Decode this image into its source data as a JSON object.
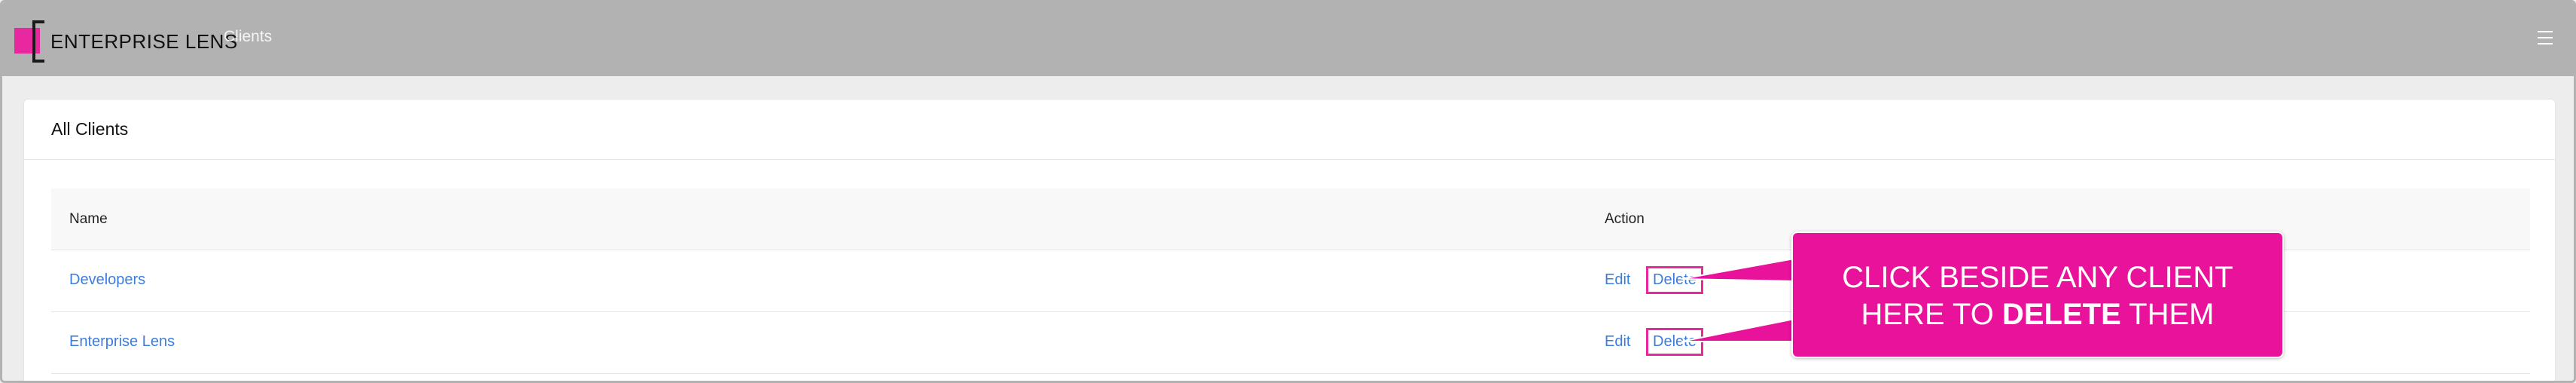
{
  "app": {
    "logo_text": "ENTERPRISE LENS",
    "nav_link": "Clients",
    "brand_color": "#e8289f"
  },
  "page": {
    "title": "All Clients"
  },
  "table": {
    "columns": [
      "Name",
      "Action"
    ],
    "rows": [
      {
        "name": "Developers",
        "edit": "Edit",
        "delete": "Delete"
      },
      {
        "name": "Enterprise Lens",
        "edit": "Edit",
        "delete": "Delete"
      }
    ]
  },
  "callout": {
    "line1": "CLICK BESIDE ANY CLIENT",
    "line2_prefix": "HERE TO ",
    "line2_bold": "DELETE",
    "line2_suffix": " THEM",
    "color": "#e8129b"
  },
  "icons": {
    "menu": "hamburger-menu-icon"
  }
}
